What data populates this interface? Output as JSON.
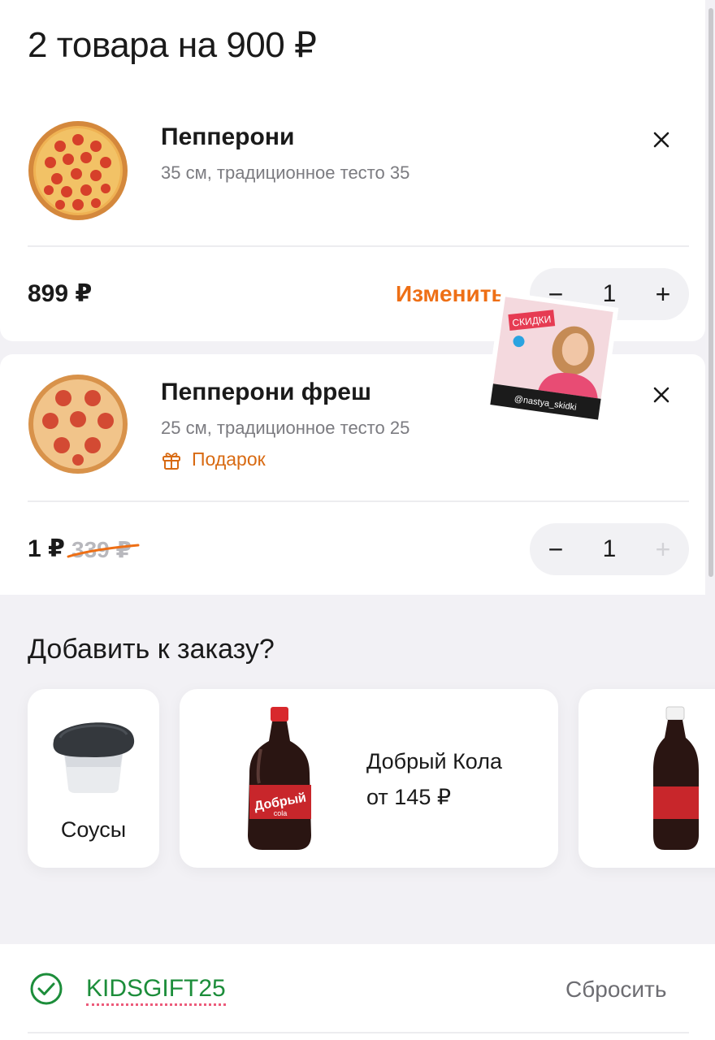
{
  "cart": {
    "title": "2 товара на 900 ₽"
  },
  "items": [
    {
      "name": "Пепперони",
      "description": "35 см, традиционное тесто 35",
      "price": "899 ₽",
      "change_label": "Изменить",
      "quantity": "1",
      "minus": "−",
      "plus": "+"
    },
    {
      "name": "Пепперони фреш",
      "description": "25 см, традиционное тесто 25",
      "gift_label": "Подарок",
      "price": "1 ₽",
      "old_price": "339 ₽",
      "quantity": "1",
      "minus": "−",
      "plus": "+"
    }
  ],
  "sticker": {
    "title": "СКИДКИ",
    "handle": "@nastya_skidki"
  },
  "upsell": {
    "title": "Добавить к заказу?",
    "sauce_label": "Соусы",
    "cola_name": "Добрый Кола",
    "cola_price": "от 145 ₽",
    "brand": "Добрый",
    "brand_sub": "cola"
  },
  "promo": {
    "code": "KIDSGIFT25",
    "reset_label": "Сбросить"
  },
  "colors": {
    "accent": "#ee6f15",
    "success": "#1c8d3a",
    "gift": "#d86a12"
  }
}
